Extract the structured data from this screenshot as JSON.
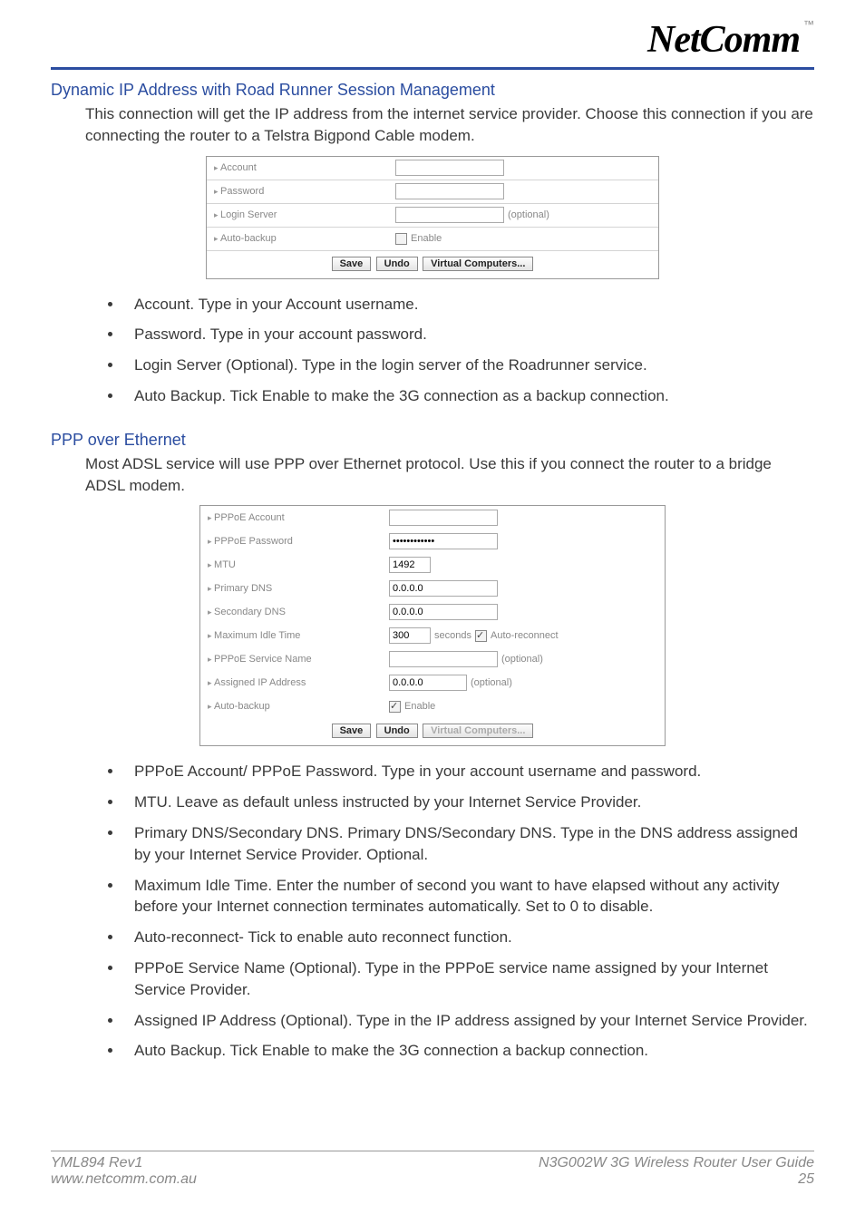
{
  "header": {
    "logo": "NetComm",
    "tm": "™"
  },
  "section1": {
    "heading": "Dynamic IP Address with Road Runner Session Management",
    "intro": "This connection will get the IP address from the internet service provider. Choose this connection if you are connecting the router to a Telstra Bigpond Cable modem.",
    "form": {
      "rows": {
        "account": "Account",
        "password": "Password",
        "login_server": "Login Server",
        "login_server_note": "(optional)",
        "auto_backup": "Auto-backup",
        "enable": "Enable"
      },
      "buttons": {
        "save": "Save",
        "undo": "Undo",
        "vc": "Virtual Computers..."
      }
    },
    "bullets": [
      "Account. Type in your Account username.",
      "Password. Type in your account password.",
      "Login Server (Optional). Type in the login server of the Roadrunner service.",
      "Auto Backup. Tick Enable to make the 3G connection as a backup connection."
    ]
  },
  "section2": {
    "heading": "PPP over Ethernet",
    "intro": "Most ADSL service will use PPP over Ethernet protocol. Use this if you connect the router to a bridge ADSL modem.",
    "form": {
      "rows": {
        "pppoe_account": "PPPoE Account",
        "pppoe_password": "PPPoE Password",
        "pppoe_password_val": "************",
        "mtu": "MTU",
        "mtu_val": "1492",
        "primary_dns": "Primary DNS",
        "primary_dns_val": "0.0.0.0",
        "secondary_dns": "Secondary DNS",
        "secondary_dns_val": "0.0.0.0",
        "max_idle": "Maximum Idle Time",
        "max_idle_val": "300",
        "seconds": "seconds",
        "auto_reconnect": "Auto-reconnect",
        "service_name": "PPPoE Service Name",
        "optional": "(optional)",
        "assigned_ip": "Assigned IP Address",
        "assigned_ip_val": "0.0.0.0",
        "auto_backup": "Auto-backup",
        "enable": "Enable"
      },
      "buttons": {
        "save": "Save",
        "undo": "Undo",
        "vc": "Virtual Computers..."
      }
    },
    "bullets": [
      "PPPoE Account/ PPPoE Password. Type in your account username and password.",
      "MTU. Leave as default unless instructed by your Internet Service Provider.",
      "Primary DNS/Secondary DNS. Primary DNS/Secondary DNS. Type in the DNS address assigned by your Internet Service Provider. Optional.",
      "Maximum Idle Time. Enter the number of second you want to have elapsed without any activity before your Internet connection terminates automatically. Set to 0 to disable.",
      "Auto-reconnect- Tick to enable auto reconnect function.",
      "PPPoE Service Name (Optional). Type in the PPPoE service name assigned by your Internet Service Provider.",
      "Assigned IP Address (Optional). Type in the IP address assigned by your Internet Service Provider.",
      "Auto Backup. Tick Enable to make the 3G connection a backup connection."
    ]
  },
  "footer": {
    "left1": "YML894 Rev1",
    "left2": "www.netcomm.com.au",
    "right1": "N3G002W 3G Wireless Router User Guide",
    "right2": "25"
  }
}
